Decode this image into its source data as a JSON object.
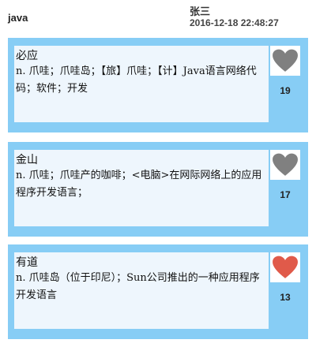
{
  "header": {
    "query": "java",
    "user": "张三",
    "timestamp": "2016-12-18 22:48:27"
  },
  "cards": [
    {
      "source": "必应",
      "definition": "n. 爪哇；爪哇岛；【旅】爪哇；【计】Java语言网络代码；软件；开发",
      "votes": "19",
      "liked": false,
      "heart_color": "#808080"
    },
    {
      "source": "金山",
      "definition": "n. 爪哇；爪哇产的咖啡；<电脑>在网际网络上的应用程序开发语言；",
      "votes": "17",
      "liked": false,
      "heart_color": "#808080"
    },
    {
      "source": "有道",
      "definition": "n. 爪哇岛（位于印尼）；Sun公司推出的一种应用程序开发语言",
      "votes": "13",
      "liked": true,
      "heart_color": "#e05a4a"
    }
  ],
  "colors": {
    "card_bg": "#87cdf5",
    "content_bg": "#eef6fd"
  },
  "icons": {
    "heart": "heart-icon"
  }
}
